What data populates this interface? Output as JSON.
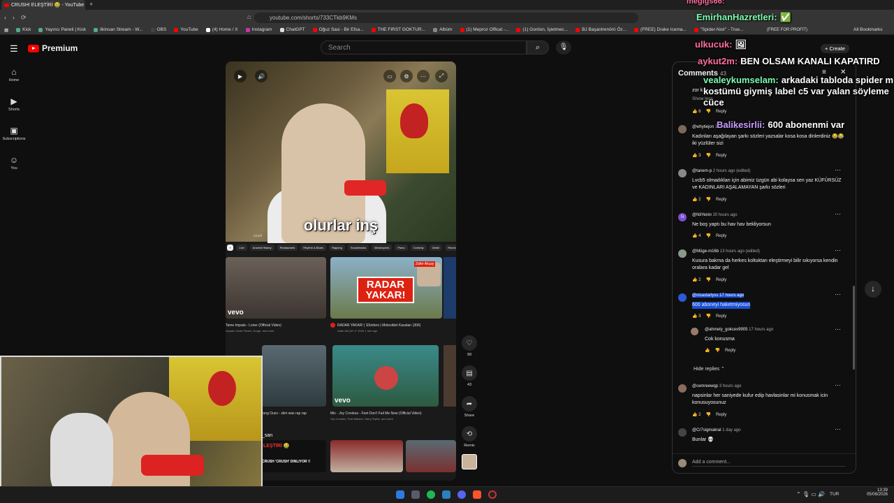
{
  "browser": {
    "tab_title": "CRUSH! ELEŞTİRİ 🤮 - YouTube",
    "url": "youtube.com/shorts/733CTkb9KMs",
    "bookmarks": [
      "Kick",
      "Yayıncı Paneli | Kick",
      "ilkinsan Stream - W...",
      "OBS",
      "YouTube",
      "(4) Home / X",
      "Instagram",
      "ChatGPT",
      "Oğuz Sasi - Bir Efsa...",
      "THE FIRST GOKTUR...",
      "Albüm",
      "(1) Meproz Offical -...",
      "(1) Gordon, İşletmec...",
      "BJ Başantrenörü Öz...",
      "(FREE) Drake Icema...",
      "\"Spider-Noir\" - True...",
      "All Bookmarks"
    ]
  },
  "youtube": {
    "logo": "Premium",
    "search_placeholder": "Search",
    "sidebar": [
      {
        "label": "Home",
        "icon": "home-icon"
      },
      {
        "label": "Shorts",
        "icon": "shorts-icon"
      },
      {
        "label": "Subscriptions",
        "icon": "subscriptions-icon"
      },
      {
        "label": "You",
        "icon": "you-icon"
      }
    ],
    "short": {
      "caption": "olurlar inş",
      "chips": [
        "crush",
        "Live",
        "Ancient History",
        "Restaurants",
        "Rhythm & Blues",
        "Rapping",
        "Soundtracks",
        "Motorcycles",
        "Piano",
        "Comedy",
        "Gebel",
        "Recently upl"
      ],
      "videos": [
        {
          "title": "Tame Impala - Loner (Official Video)",
          "meta": "Impala, Kevin Parker, Gorge, and more"
        },
        {
          "title": "RADAR YAKAR! | SSriders | Motosiklet Kazaları (306)",
          "meta": "Zafer AKÇAY ✔ 224K 1 min ago"
        },
        {
          "title": "fung Ouzo - slim was rap rap",
          "meta": ""
        },
        {
          "title": "Mix - Joy Crookes - Feet Don't Fail Me Now (Official Video)",
          "meta": "Joy Crookes, Post Malone, Harry Styles, and more"
        },
        {
          "title": "CRUSH 'CRUSH' DİNLİYOR !!",
          "meta": ""
        }
      ],
      "thumb_overlay": "RADAR YAKAR!",
      "thumb_person": "Zafer Akçay",
      "vevo": "vevo",
      "san_label": "_san",
      "crush_title": "LEŞTİRİ 🤮"
    },
    "actions": [
      {
        "label": "99",
        "icon": "like-icon"
      },
      {
        "label": "43",
        "icon": "comment-icon"
      },
      {
        "label": "Share",
        "icon": "share-icon"
      },
      {
        "label": "Remix",
        "icon": "remix-icon"
      }
    ]
  },
  "comments": {
    "title": "Comments",
    "count": "43",
    "show_more": "Show less",
    "reply_label": "Reply",
    "items": [
      {
        "user": "@whytiejon",
        "time": "15 hours ago",
        "text": "Kadınları aşağılayan şarkı sözleri yazsalar kosa kosa dinlerdiniz 😂😂 iki yüzlüler sizi",
        "likes": "3"
      },
      {
        "user": "@tanem-p",
        "time": "2 hours ago (edited)",
        "text": "Lvcb5 olmadıkları için abimiz üzgün abi kolaysa sen yaz KÜFÜRSÜZ ve KADINLARI AŞALAMAYAN şarkı sözleri",
        "likes": "2"
      },
      {
        "user": "@NilYenin",
        "time": "20 hours ago",
        "text": "Ne boş yaptı bu hav hav bekliyorsun",
        "likes": "4"
      },
      {
        "user": "@Müge-m16b",
        "time": "13 hours ago (edited)",
        "text": "Kusura bakma da herkes koltuktan eleştirmeyi bilir sıkıyorsa kendin oralara kadar gel",
        "likes": "2"
      },
      {
        "user": "@nisastarlyss",
        "time": "17 hours ago",
        "text": "600 aboneyi haketmiyosun",
        "likes": "3"
      },
      {
        "user": "@ahmety_gokcex9905",
        "time": "17 hours ago",
        "text": "Cok konusma",
        "likes": ""
      },
      {
        "user": "@cemreewqp",
        "time": "3 hours ago",
        "text": "napsinlar her saniyede kufur edip havlasinlar mi konusmak icin konusuyosunuz",
        "likes": "2"
      },
      {
        "user": "@Cr7sigmakral",
        "time": "1 day ago",
        "text": "Bunlar 💀",
        "likes": ""
      }
    ],
    "hide_replies": "Hide replies",
    "add_placeholder": "Add a comment...",
    "truncated_top": "zor k"
  },
  "chat_overlay": [
    {
      "user": "megigs66:",
      "msg": "",
      "color": "#ff6fa0"
    },
    {
      "user": "EmirhanHazretleri:",
      "msg": "✅",
      "color": "#7cffb0"
    },
    {
      "user": "ulkucuk:",
      "msg": "🖼",
      "color": "#ff6fa0"
    },
    {
      "user": "aykut2m:",
      "msg": "BEN OLSAM KANALI KAPATIRD",
      "color": "#ff6fa0"
    },
    {
      "user": "vealeykumselam:",
      "msg": "arkadaki tabloda spider m kostümü giymiş label c5 var yalan söyleme cüce",
      "color": "#7cffb0"
    },
    {
      "user": "Balikesirlii:",
      "msg": "600 abonenmi var",
      "color": "#c79bff"
    }
  ],
  "overlay_create": "+ Create",
  "overlay_free": "(FREE FOR PROFIT)",
  "taskbar": {
    "lang": "TUR",
    "time": "13:39",
    "date": "05/08/2026"
  },
  "colors": {
    "accent": "#ff0000",
    "select": "#1a4fd8",
    "bg": "#0f0f0f"
  }
}
